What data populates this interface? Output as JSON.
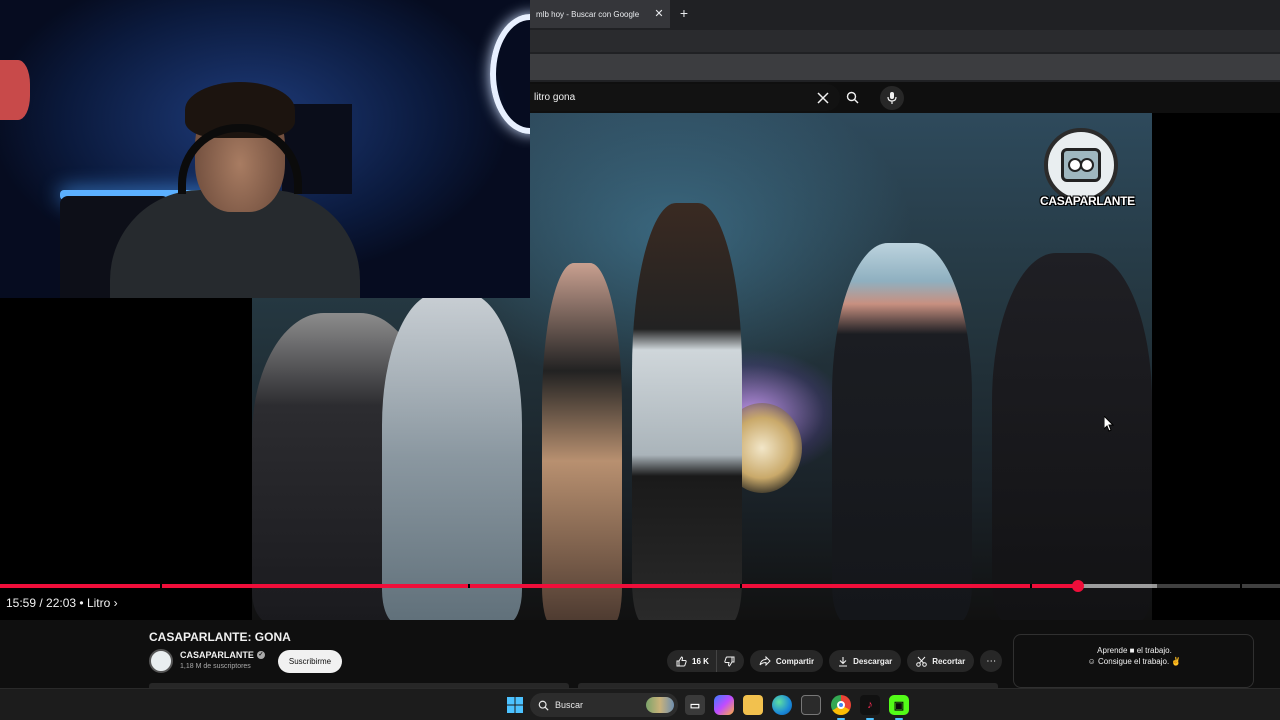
{
  "browser": {
    "tab_title": "mlb hoy - Buscar con Google",
    "tab_close": "✕",
    "new_tab": "+"
  },
  "search": {
    "query": "litro gona"
  },
  "video": {
    "watermark": "CASAPARLANTE",
    "time": "15:59 / 22:03",
    "chapter": "• Litro ›",
    "progress_played": 0.842,
    "progress_loaded": 0.904
  },
  "info": {
    "title": "CASAPARLANTE: GONA",
    "channel": "CASAPARLANTE",
    "subscribers": "1,18 M de suscriptores",
    "subscribe": "Suscribirme",
    "likes": "16 K",
    "share": "Compartir",
    "download": "Descargar",
    "clip": "Recortar",
    "more": "⋯"
  },
  "ad": {
    "line1": "Aprende ■ el trabajo.",
    "line2": "☺ Consigue el trabajo. ✌"
  },
  "taskbar": {
    "search": "Buscar"
  },
  "colors": {
    "accent": "#f00e3a",
    "taskbar_active": "#4cc2ff"
  }
}
